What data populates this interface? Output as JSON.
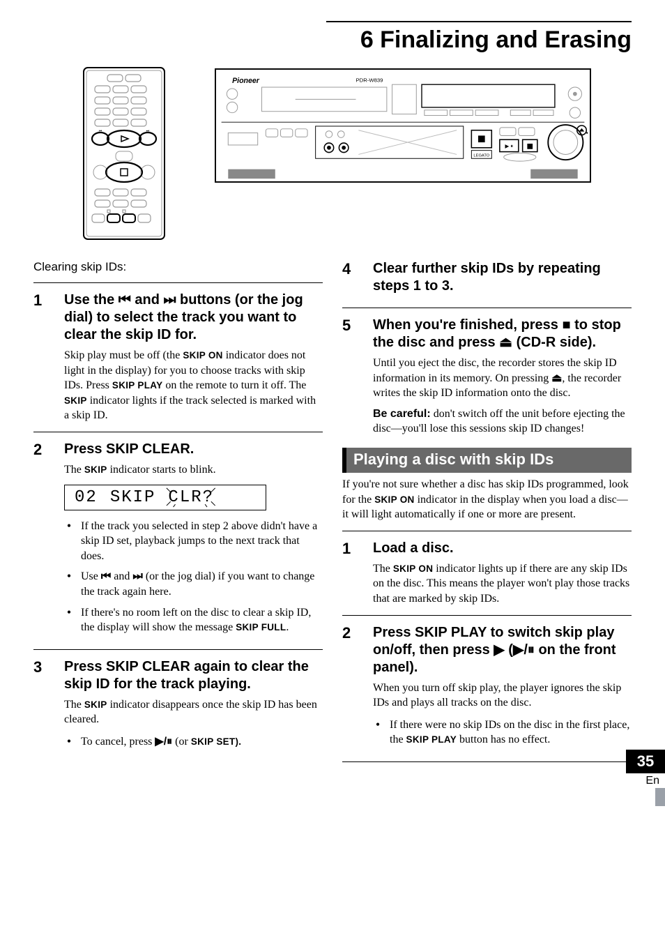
{
  "chapter": {
    "title": "6 Finalizing and Erasing"
  },
  "clearing": {
    "intro": "Clearing skip IDs:",
    "step1": {
      "num": "1",
      "head_pre": "Use the ",
      "head_mid": " and ",
      "head_post": " buttons (or the jog dial) to select  the track you want to clear the skip ID for.",
      "body_a": "Skip play must be off (the ",
      "sc_a": "SKIP ON",
      "body_b": " indicator does not light in the display) for you to choose tracks with skip IDs. Press ",
      "sc_b": "SKIP PLAY",
      "body_c": " on the remote to turn it off.  The ",
      "sc_c": "SKIP",
      "body_d": " indicator lights if the track selected is marked with a skip ID."
    },
    "step2": {
      "num": "2",
      "head": "Press SKIP CLEAR.",
      "body_a": "The ",
      "sc_a": "SKIP",
      "body_b": " indicator starts to blink.",
      "display": {
        "d1": "02",
        "d2": "SKIP",
        "d3": "CLR?"
      },
      "b1": "If the track you selected in step 2 above didn't have a skip ID set, playback jumps to the next track that does.",
      "b2_pre": "Use ",
      "b2_mid": " and ",
      "b2_post": " (or the jog dial) if you want to change the track again here.",
      "b3_a": "If there's no room left on the disc to clear a skip ID, the display will show the message ",
      "b3_sc": "SKIP FULL",
      "b3_b": "."
    },
    "step3": {
      "num": "3",
      "head": "Press SKIP CLEAR again to clear the skip ID for the track playing.",
      "body_a": "The ",
      "sc_a": "SKIP",
      "body_b": " indicator disappears once the skip ID has been cleared.",
      "b1_a": "To cancel, press ",
      "b1_mid": " (or ",
      "b1_sc": "SKIP SET",
      "b1_b": ")."
    },
    "step4": {
      "num": "4",
      "head": "Clear further skip IDs by repeating steps 1 to 3."
    },
    "step5": {
      "num": "5",
      "head_a": "When you're finished, press ",
      "head_b": " to stop the disc and press ",
      "head_c": " (CD-R side).",
      "body_a": "Until you eject the disc, the recorder stores the skip ID information in its memory. On pressing ",
      "body_b": ", the recorder writes the skip ID information onto the disc.",
      "care_label": "Be careful:",
      "care_body": " don't switch off the unit before ejecting the disc—you'll lose this sessions skip ID changes!"
    }
  },
  "play": {
    "bar": "Playing a disc with skip IDs",
    "intro_a": "If you're not sure whether a disc has skip IDs programmed, look for the ",
    "intro_sc": "SKIP ON",
    "intro_b": " indicator in the display when you load a disc—it will light automatically if one or more are present.",
    "step1": {
      "num": "1",
      "head": "Load a disc.",
      "body_a": "The ",
      "sc_a": "SKIP ON",
      "body_b": " indicator lights up if there are any skip IDs on the disc. This means the player won't play those tracks that are marked by skip IDs."
    },
    "step2": {
      "num": "2",
      "head_a": "Press SKIP PLAY to switch skip play on/off, then press ",
      "head_b": " (",
      "head_c": " on the front panel).",
      "body": "When you turn off skip play, the player ignores the skip IDs and plays all tracks on the disc.",
      "b1_a": "If there were no skip IDs on the disc in the first place, the ",
      "b1_sc": "SKIP PLAY",
      "b1_b": " button has no effect."
    }
  },
  "page": {
    "num": "35",
    "lang": "En"
  },
  "icons": {
    "prev": "prev-track-icon",
    "next": "next-track-icon",
    "stop": "stop-icon",
    "eject": "eject-icon",
    "play": "play-icon",
    "playpause": "play-pause-icon"
  }
}
